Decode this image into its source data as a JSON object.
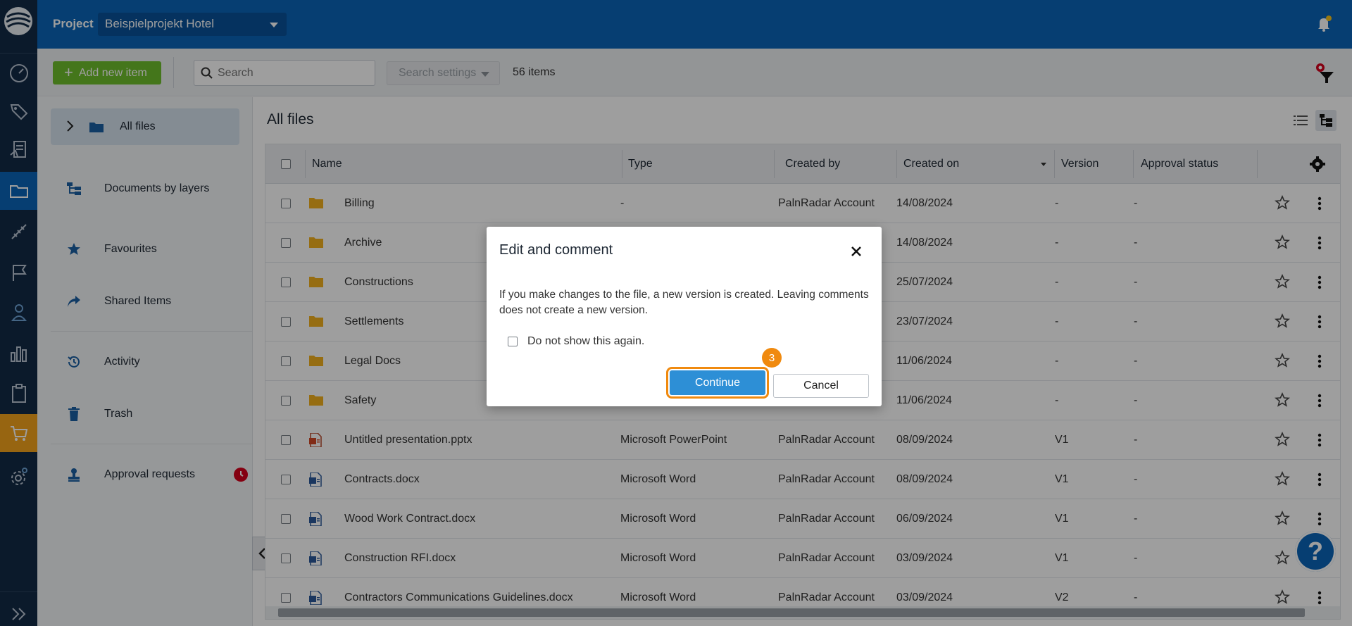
{
  "header": {
    "project_label": "Project",
    "project_name": "Beispielprojekt Hotel"
  },
  "toolbar": {
    "add_label": "Add new item",
    "search_placeholder": "Search",
    "search_settings_label": "Search settings",
    "items_count": "56 items"
  },
  "sidenav": {
    "items": [
      {
        "label": "All files",
        "icon": "folder-icon"
      },
      {
        "label": "Documents by layers",
        "icon": "layers-icon"
      },
      {
        "label": "Favourites",
        "icon": "star-icon"
      },
      {
        "label": "Shared Items",
        "icon": "share-icon"
      },
      {
        "label": "Activity",
        "icon": "history-icon"
      },
      {
        "label": "Trash",
        "icon": "trash-icon"
      },
      {
        "label": "Approval requests",
        "icon": "stamp-icon"
      }
    ]
  },
  "main": {
    "title": "All files",
    "columns": [
      "Name",
      "Type",
      "Created by",
      "Created on",
      "Version",
      "Approval status"
    ],
    "rows": [
      {
        "kind": "folder",
        "name": "Billing",
        "type": "-",
        "created_by": "PalnRadar Account",
        "created_on": "14/08/2024",
        "version": "-",
        "approval": "-"
      },
      {
        "kind": "folder",
        "name": "Archive",
        "type": "",
        "created_by": "",
        "created_on": "14/08/2024",
        "version": "-",
        "approval": "-"
      },
      {
        "kind": "folder",
        "name": "Constructions",
        "type": "",
        "created_by": "",
        "created_on": "25/07/2024",
        "version": "-",
        "approval": "-"
      },
      {
        "kind": "folder",
        "name": "Settlements",
        "type": "",
        "created_by": "",
        "created_on": "23/07/2024",
        "version": "-",
        "approval": "-"
      },
      {
        "kind": "folder",
        "name": "Legal Docs",
        "type": "",
        "created_by": "",
        "created_on": "11/06/2024",
        "version": "-",
        "approval": "-"
      },
      {
        "kind": "folder",
        "name": "Safety",
        "type": "",
        "created_by": "",
        "created_on": "11/06/2024",
        "version": "-",
        "approval": "-"
      },
      {
        "kind": "pptx",
        "name": "Untitled presentation.pptx",
        "type": "Microsoft PowerPoint",
        "created_by": "PalnRadar Account",
        "created_on": "08/09/2024",
        "version": "V1",
        "approval": "-"
      },
      {
        "kind": "docx",
        "name": "Contracts.docx",
        "type": "Microsoft Word",
        "created_by": "PalnRadar Account",
        "created_on": "08/09/2024",
        "version": "V1",
        "approval": "-"
      },
      {
        "kind": "docx",
        "name": "Wood Work Contract.docx",
        "type": "Microsoft Word",
        "created_by": "PalnRadar Account",
        "created_on": "06/09/2024",
        "version": "V1",
        "approval": "-"
      },
      {
        "kind": "docx",
        "name": "Construction RFI.docx",
        "type": "Microsoft Word",
        "created_by": "PalnRadar Account",
        "created_on": "03/09/2024",
        "version": "V1",
        "approval": "-"
      },
      {
        "kind": "docx",
        "name": "Contractors Communications Guidelines.docx",
        "type": "Microsoft Word",
        "created_by": "PalnRadar Account",
        "created_on": "03/09/2024",
        "version": "V2",
        "approval": "-"
      }
    ]
  },
  "dialog": {
    "title": "Edit and comment",
    "message": "If you make changes to the file, a new version is created. Leaving comments does not create a new version.",
    "checkbox_label": "Do not show this again.",
    "continue_label": "Continue",
    "cancel_label": "Cancel",
    "step_number": "3"
  },
  "help": {
    "label": "?"
  },
  "colors": {
    "primary": "#0b65b8",
    "rail": "#122b46",
    "add_button": "#6fbf2d",
    "highlight": "#f08a0f",
    "folder": "#f2b01e"
  }
}
